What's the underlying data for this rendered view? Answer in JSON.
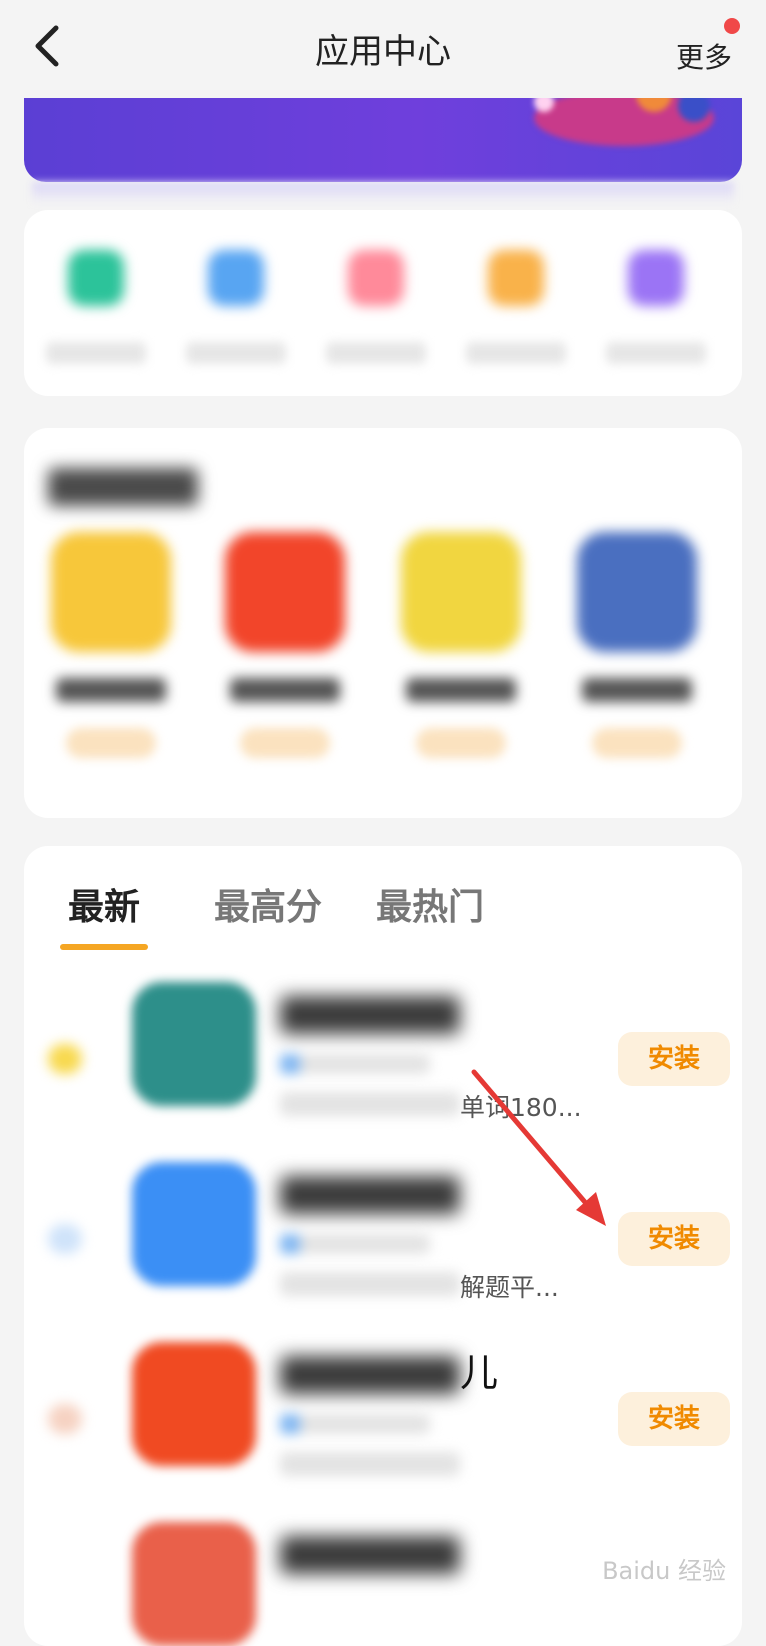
{
  "header": {
    "title": "应用中心",
    "more_label": "更多",
    "notification_dot_color": "#f04848"
  },
  "quick_entries": [
    {
      "color": "#2cc39a"
    },
    {
      "color": "#58a5f2"
    },
    {
      "color": "#ff8a9a"
    },
    {
      "color": "#f9b24a"
    },
    {
      "color": "#9b74f5"
    }
  ],
  "recommended": {
    "apps": [
      {
        "color": "#f7c73a"
      },
      {
        "color": "#f2452a"
      },
      {
        "color": "#f1d640"
      },
      {
        "color": "#4a6fc0"
      }
    ]
  },
  "list": {
    "tabs": [
      {
        "label": "最新",
        "active": true
      },
      {
        "label": "最高分",
        "active": false
      },
      {
        "label": "最热门",
        "active": false
      }
    ],
    "items": [
      {
        "desc_tail": "单词180...",
        "name_tail": "",
        "install_label": "安装",
        "icon_color": "#2d8f8a",
        "side_color": "#f8d94f"
      },
      {
        "desc_tail": "解题平...",
        "name_tail": "",
        "install_label": "安装",
        "icon_color": "#3b8ff5",
        "side_color": "#cfe3fa"
      },
      {
        "desc_tail": "",
        "name_tail": "儿",
        "install_label": "安装",
        "icon_color": "#f04a22",
        "side_color": "#f6d2c2"
      },
      {
        "desc_tail": "",
        "name_tail": "",
        "install_label": "",
        "icon_color": "#e9604a",
        "side_color": "#f4f4f4"
      }
    ]
  },
  "watermark": "Baidu 经验"
}
